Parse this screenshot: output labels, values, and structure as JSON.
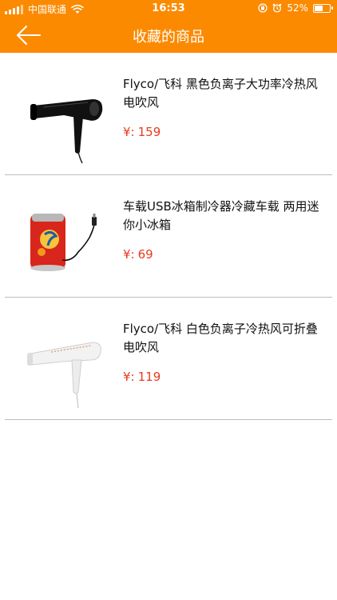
{
  "status": {
    "carrier": "中国联通",
    "time": "16:53",
    "battery": "52%",
    "battery_fraction": 0.52
  },
  "nav": {
    "title": "收藏的商品",
    "back_icon": "arrow-left-icon"
  },
  "products": [
    {
      "name": "Flyco/飞科  黑色负离子大功率冷热风电吹风",
      "currency": "¥:",
      "price": "159",
      "image": "black-hair-dryer"
    },
    {
      "name": "车载USB冰箱制冷器冷藏车载 两用迷你小冰箱",
      "currency": "¥:",
      "price": "69",
      "image": "mini-usb-fridge"
    },
    {
      "name": "Flyco/飞科  白色负离子冷热风可折叠电吹风",
      "currency": "¥:",
      "price": "119",
      "image": "white-hair-dryer"
    }
  ],
  "colors": {
    "accent": "#fb8a00",
    "price": "#e93a20",
    "divider": "#bdbdbd"
  }
}
